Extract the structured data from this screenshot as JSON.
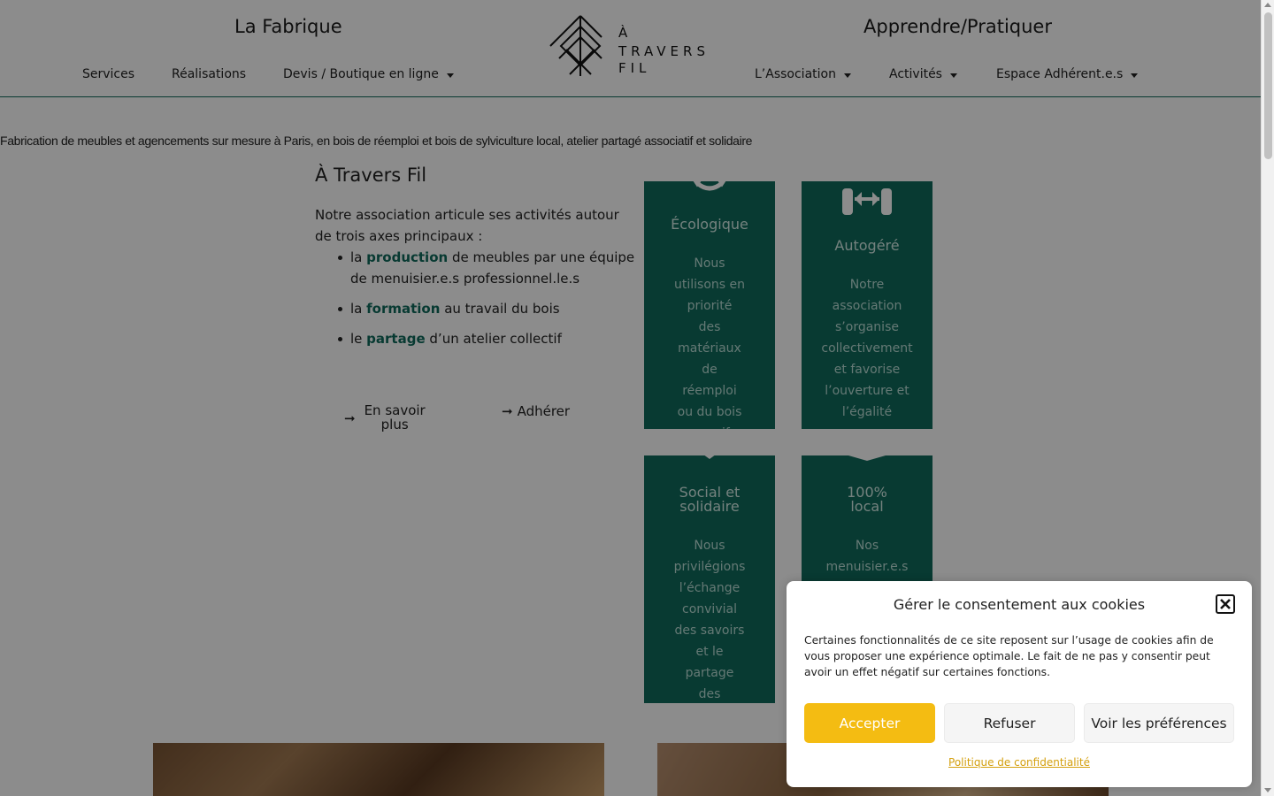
{
  "header": {
    "left_title": "La Fabrique",
    "right_title": "Apprendre/Pratiquer",
    "left_nav": [
      {
        "label": "Services"
      },
      {
        "label": "Réalisations"
      },
      {
        "label": "Devis / Boutique en ligne"
      }
    ],
    "right_nav": [
      {
        "label": "L’Association"
      },
      {
        "label": "Activités"
      },
      {
        "label": "Espace Adhérent.e.s"
      }
    ],
    "logo": {
      "line1": "À",
      "line2": "TRAVERS",
      "line3": "FIL",
      "icon": "pine-tree-logo-icon"
    }
  },
  "tagline": "Fabrication de meubles et agencements sur mesure à Paris, en bois de réemploi et bois de sylviculture local, atelier partagé associatif et solidaire",
  "intro": {
    "title": "À Travers Fil",
    "text": "Notre association articule ses activités autour de trois axes principaux :",
    "items": [
      {
        "pre": "la ",
        "kw": "production",
        "post": " de meubles par une équipe de menuisier.e.s professionnel.le.s"
      },
      {
        "pre": "la ",
        "kw": "formation",
        "post": " au travail du bois"
      },
      {
        "pre": "le ",
        "kw": "partage",
        "post": " d’un atelier collectif"
      }
    ],
    "btn_more_line1": "En savoir",
    "btn_more_line2": "plus",
    "btn_join": "Adhérer"
  },
  "cards": [
    {
      "title": "Écologique",
      "text": "Nous utilisons en priorité des matériaux de réemploi ou du bois massif",
      "icon": "recycle-icon"
    },
    {
      "title": "Autogéré",
      "text": "Notre association s’organise collectivement et favorise l’ouverture et l’égalité",
      "icon": "handshake-icon"
    },
    {
      "title_line1": "Social et",
      "title_line2": "solidaire",
      "text": "Nous privilégions l’échange convivial des savoirs et le partage des",
      "icon": "heart-hands-icon"
    },
    {
      "title_line1": "100%",
      "title_line2": "local",
      "text": "Nos menuisier.e.s",
      "icon": "map-pin-icon"
    }
  ],
  "cookie": {
    "title": "Gérer le consentement aux cookies",
    "text": "Certaines fonctionnalités de ce site reposent sur l’usage de cookies afin de vous proposer une expérience optimale. Le fait de ne pas y consentir peut avoir un effet négatif sur certaines fonctions.",
    "accept": "Accepter",
    "refuse": "Refuser",
    "prefs": "Voir les préférences",
    "policy": "Politique de confidentialité"
  },
  "colors": {
    "accent": "#0f6b5c",
    "accept": "#f4bc12"
  }
}
